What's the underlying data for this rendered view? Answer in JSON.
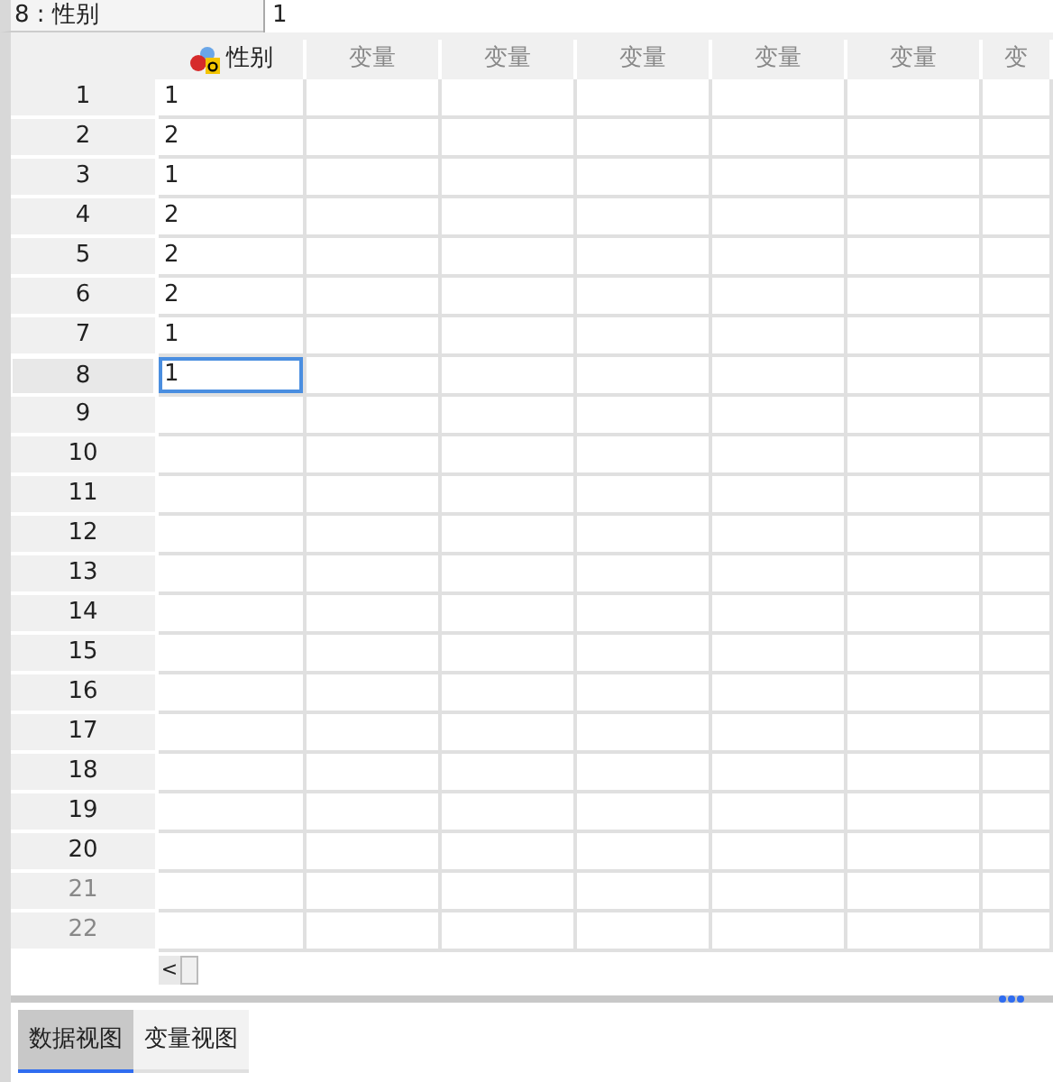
{
  "cell_reference": "8 : 性别",
  "cell_value": "1",
  "columns": [
    {
      "label": "性别",
      "kind": "variable"
    },
    {
      "label": "变量",
      "kind": "empty"
    },
    {
      "label": "变量",
      "kind": "empty"
    },
    {
      "label": "变量",
      "kind": "empty"
    },
    {
      "label": "变量",
      "kind": "empty"
    },
    {
      "label": "变量",
      "kind": "empty"
    },
    {
      "label": "变",
      "kind": "empty"
    }
  ],
  "rows": [
    {
      "number": "1",
      "value": "1",
      "selected": false,
      "greyed": false
    },
    {
      "number": "2",
      "value": "2",
      "selected": false,
      "greyed": false
    },
    {
      "number": "3",
      "value": "1",
      "selected": false,
      "greyed": false
    },
    {
      "number": "4",
      "value": "2",
      "selected": false,
      "greyed": false
    },
    {
      "number": "5",
      "value": "2",
      "selected": false,
      "greyed": false
    },
    {
      "number": "6",
      "value": "2",
      "selected": false,
      "greyed": false
    },
    {
      "number": "7",
      "value": "1",
      "selected": false,
      "greyed": false
    },
    {
      "number": "8",
      "value": "1",
      "selected": true,
      "greyed": false
    },
    {
      "number": "9",
      "selected": false,
      "greyed": false
    },
    {
      "number": "10",
      "selected": false,
      "greyed": false
    },
    {
      "number": "11",
      "selected": false,
      "greyed": false
    },
    {
      "number": "12",
      "selected": false,
      "greyed": false
    },
    {
      "number": "13",
      "selected": false,
      "greyed": false
    },
    {
      "number": "14",
      "selected": false,
      "greyed": false
    },
    {
      "number": "15",
      "selected": false,
      "greyed": false
    },
    {
      "number": "16",
      "selected": false,
      "greyed": false
    },
    {
      "number": "17",
      "selected": false,
      "greyed": false
    },
    {
      "number": "18",
      "selected": false,
      "greyed": false
    },
    {
      "number": "19",
      "selected": false,
      "greyed": false
    },
    {
      "number": "20",
      "selected": false,
      "greyed": false
    },
    {
      "number": "21",
      "selected": false,
      "greyed": true
    },
    {
      "number": "22",
      "selected": false,
      "greyed": true
    }
  ],
  "scroll_left": "<",
  "tabs": [
    {
      "label": "数据视图",
      "selected": true
    },
    {
      "label": "变量视图",
      "selected": false
    }
  ]
}
